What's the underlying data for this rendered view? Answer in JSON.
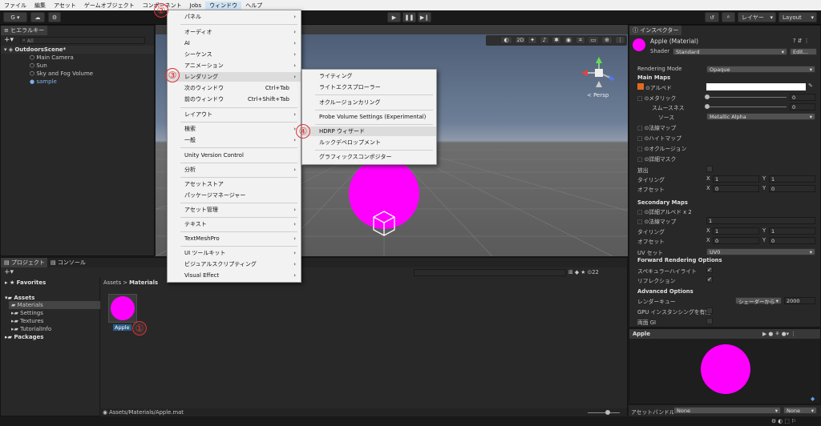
{
  "menubar": {
    "items": [
      "ファイル",
      "編集",
      "アセット",
      "ゲームオブジェクト",
      "コンポーネント",
      "Jobs",
      "ウィンドウ",
      "ヘルプ"
    ]
  },
  "toolbar": {
    "account": "G ▾",
    "layers": "レイヤー",
    "layout": "Layout"
  },
  "hierarchy": {
    "tab": "ヒエラルキー",
    "search_placeholder": "All",
    "scene": "OutdoorsScene*",
    "items": [
      "Main Camera",
      "Sun",
      "Sky and Fog Volume",
      "sample"
    ]
  },
  "scene_view": {
    "persp": "< Persp",
    "btn_2d": "2D"
  },
  "window_menu": {
    "items": [
      "パネル",
      "オーディオ",
      "AI",
      "シーケンス",
      "アニメーション",
      "レンダリング",
      "次のウィンドウ",
      "前のウィンドウ",
      "レイアウト",
      "検索",
      "一般",
      "Unity Version Control",
      "分析",
      "アセットストア",
      "パッケージマネージャー",
      "アセット管理",
      "テキスト",
      "TextMeshPro",
      "UI ツールキット",
      "ビジュアルスクリプティング",
      "Visual Effect"
    ],
    "shortcuts": {
      "next": "Ctrl+Tab",
      "prev": "Ctrl+Shift+Tab"
    }
  },
  "render_menu": {
    "items": [
      "ライティング",
      "ライトエクスプローラー",
      "オクルージョンカリング",
      "Probe Volume Settings (Experimental)",
      "HDRP ウィザード",
      "ルックデベロップメント",
      "グラフィックスコンポジター"
    ]
  },
  "badges": [
    "①",
    "②",
    "③",
    "④"
  ],
  "project": {
    "tabs": [
      "プロジェクト",
      "コンソール"
    ],
    "favorites": "Favorites",
    "assets": "Assets",
    "folders": [
      "Materials",
      "Settings",
      "Textures",
      "TutorialInfo"
    ],
    "packages": "Packages",
    "breadcrumb_root": "Assets",
    "breadcrumb_leaf": "Materials",
    "asset_name": "Apple",
    "path": "Assets/Materials/Apple.mat",
    "count": "22"
  },
  "inspector": {
    "tab": "インスペクター",
    "title": "Apple (Material)",
    "shader_label": "Shader",
    "shader_value": "Standard",
    "edit_button": "Edit...",
    "rendering_mode_label": "Rendering Mode",
    "rendering_mode_value": "Opaque",
    "main_maps": "Main Maps",
    "albedo": "アルベド",
    "metallic": "メタリック",
    "metallic_value": "0",
    "smoothness": "スムースネス",
    "smoothness_value": "0",
    "source": "ソース",
    "source_value": "Metallic Alpha",
    "normal_map": "法線マップ",
    "height_map": "ハイトマップ",
    "occlusion": "オクルージョン",
    "detail_mask": "詳細マスク",
    "emission": "放出",
    "tiling": "タイリング",
    "offset": "オフセット",
    "x_label": "X",
    "y_label": "Y",
    "tiling_x": "1",
    "tiling_y": "1",
    "offset_x": "0",
    "offset_y": "0",
    "secondary_maps": "Secondary Maps",
    "detail_albedo": "詳細アルベド x 2",
    "sec_normal": "法線マップ",
    "sec_normal_value": "1",
    "sec_tiling_x": "1",
    "sec_tiling_y": "1",
    "sec_offset_x": "0",
    "sec_offset_y": "0",
    "uv_set": "UV セット",
    "uv_value": "UV0",
    "forward_options": "Forward Rendering Options",
    "specular": "スペキュラーハイライト",
    "reflection": "リフレクション",
    "advanced": "Advanced Options",
    "render_queue": "レンダーキュー",
    "render_queue_mode": "シェーダーから",
    "render_queue_value": "2000",
    "gpu_instancing": "GPU インスタンシングを有効",
    "double_gi": "両面 GI",
    "preview_name": "Apple",
    "asset_bundle": "アセットバンドル",
    "asset_bundle_value": "None",
    "asset_bundle_variant": "None"
  },
  "colors": {
    "magenta": "#ff00ff",
    "accent": "#2c5d87",
    "badge": "#e23030"
  }
}
